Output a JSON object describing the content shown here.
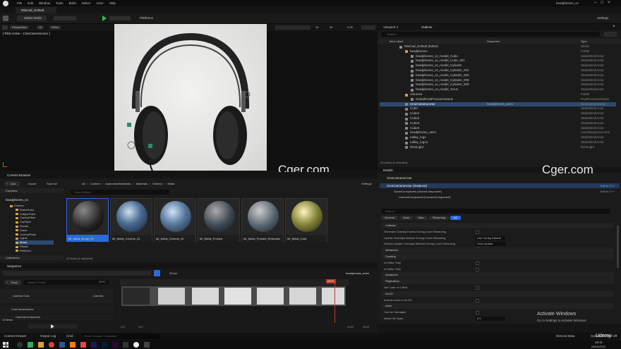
{
  "window": {
    "title": "headphones_xs",
    "menus": [
      "File",
      "Edit",
      "Window",
      "Tools",
      "Build",
      "Select",
      "Actor",
      "Help"
    ],
    "level_tab": "Minimal_Default"
  },
  "toolbar": {
    "select_mode": "Select Mode",
    "platforms": "Platforms",
    "settings": "Settings"
  },
  "viewport": {
    "perspective": "Perspective",
    "lit": "Lit",
    "show": "Show",
    "pilot": "[ Pilot Active - CineCameraActor ]",
    "fov": "90",
    "scale": "0.25",
    "snap": "10"
  },
  "watermark": "Cger.com",
  "outliner": {
    "tab_viewport2": "Viewport 2",
    "tab_outliner": "Outliner",
    "search_placeholder": "Search...",
    "col_label": "Item Label",
    "col_sequence": "Sequence",
    "col_type": "Type",
    "footer": "23 actors (1 selected)",
    "rows": [
      {
        "name": "Minimal_Default (Editor)",
        "type": "World",
        "seq": ""
      },
      {
        "name": "headphones",
        "type": "Folder",
        "seq": ""
      },
      {
        "name": "headphones_xs_model_Cube",
        "type": "StaticMeshActor",
        "seq": ""
      },
      {
        "name": "headphones_xs_model_Cube_001",
        "type": "StaticMeshActor",
        "seq": ""
      },
      {
        "name": "headphones_xs_model_Cylinder",
        "type": "StaticMeshActor",
        "seq": ""
      },
      {
        "name": "headphones_xs_model_Cylinder_002",
        "type": "StaticMeshActor",
        "seq": ""
      },
      {
        "name": "headphones_xs_model_Cylinder_003",
        "type": "StaticMeshActor",
        "seq": ""
      },
      {
        "name": "headphones_xs_model_Cylinder_008",
        "type": "StaticMeshActor",
        "seq": ""
      },
      {
        "name": "headphones_xs_model_Cylinder_009",
        "type": "StaticMeshActor",
        "seq": ""
      },
      {
        "name": "headphones_xs_model_Torus",
        "type": "StaticMeshActor",
        "seq": ""
      },
      {
        "name": "Volumes",
        "type": "Folder",
        "seq": ""
      },
      {
        "name": "GlobalPostProcessVolume",
        "type": "PostProcessVolume",
        "seq": ""
      },
      {
        "name": "CineCameraActor",
        "type": "CineCameraActor",
        "seq": "headphones_anim"
      },
      {
        "name": "Cube",
        "type": "StaticMeshActor",
        "seq": ""
      },
      {
        "name": "Cube2",
        "type": "StaticMeshActor",
        "seq": ""
      },
      {
        "name": "Cube3",
        "type": "StaticMeshActor",
        "seq": ""
      },
      {
        "name": "Cube4",
        "type": "StaticMeshActor",
        "seq": ""
      },
      {
        "name": "Cube5",
        "type": "StaticMeshActor",
        "seq": ""
      },
      {
        "name": "headphones_anim",
        "type": "LevelSequenceActor",
        "seq": ""
      },
      {
        "name": "nallay_logo",
        "type": "StaticMeshActor",
        "seq": ""
      },
      {
        "name": "nallay_logo2",
        "type": "StaticMeshActor",
        "seq": ""
      },
      {
        "name": "RectLight",
        "type": "RectLight",
        "seq": ""
      }
    ]
  },
  "details": {
    "tab": "Details",
    "actor_name": "CineCameraActor",
    "instance": "CineCameraActor (Instance)",
    "component1": "SceneComponent (SceneComponent)",
    "component2": "CameraComponent (CameraComponent)",
    "edit_cpp": "Edit in C++",
    "search_placeholder": "Search",
    "filters": [
      "General",
      "Actor",
      "Misc",
      "Streaming",
      "All"
    ],
    "rows": [
      {
        "section": "Collision"
      },
      {
        "label": "Generate Overlap Events During Level Streaming",
        "value": ""
      },
      {
        "label": "Update Overlaps Method During Level Streaming",
        "value": "Use Config Default"
      },
      {
        "label": "Default Update Overlaps Method During Level Streaming",
        "value": "Only Update Movable"
      },
      {
        "section": "Advanced"
      },
      {
        "section": "Cooking"
      },
      {
        "label": "Is Editor Only",
        "value": ""
      },
      {
        "label": "Is Editor Only",
        "value": ""
      },
      {
        "section": "Advanced"
      },
      {
        "section": "Replication"
      },
      {
        "label": "Net Load on Client",
        "value": ""
      },
      {
        "section": "HLOD"
      },
      {
        "label": "Include Actor in HLOD",
        "value": ""
      },
      {
        "section": "Actor"
      },
      {
        "label": "Can be Damaged",
        "value": ""
      },
      {
        "label": "Initial Life Span",
        "value": "0.0"
      }
    ]
  },
  "content_browser": {
    "tab": "Content Browser",
    "add": "Add",
    "import": "Import",
    "save_all": "Save All",
    "settings": "Settings",
    "breadcrumb": [
      "All",
      "Content",
      "AutomotiveMaterials",
      "Materials",
      "Exterior",
      "Metal"
    ],
    "favorites": "Favorites",
    "root": "headphones_xs",
    "search_placeholder": "Search Metal",
    "collections": "Collections",
    "status": "22 items (1 selected)",
    "folders": [
      "Exterior",
      "BrakeRotor",
      "CaliperPaint",
      "CarbonFiber",
      "CarPaint",
      "Decals",
      "Glass",
      "LicensePlate",
      "Lights",
      "Metal",
      "Plastic",
      "Reflector"
    ],
    "assets": [
      "MI_Metal_Bump_02",
      "MI_Metal_Chrome_01",
      "MI_Metal_Chrome_02",
      "MI_Metal_Frosted",
      "MI_Metal_Frosted_Reflection",
      "MI_Metal_Gold"
    ]
  },
  "sequencer": {
    "tab": "Sequence",
    "track": "Track",
    "search_placeholder": "Search Tracks",
    "fps": "30 fps",
    "sequence_name": "headphones_anim",
    "frame_start": "0000",
    "frame_current": "0473",
    "time_label": "0473",
    "camera_cuts": "Camera Cuts",
    "camera_btn": "Camera",
    "cine_actor": "CineCameraActor",
    "camera_component": "CameraComponent",
    "items_count": "19 items",
    "start_a": "-017",
    "start_b": "-007",
    "end_a": "0590",
    "end_b": "0595"
  },
  "statusbar": {
    "content_drawer": "Content Drawer",
    "output_log": "Output Log",
    "cmd": "Cmd",
    "cmd_placeholder": "Enter Console Command",
    "derived_data": "Derived Data",
    "source_control": "Source Control Off"
  },
  "activate": {
    "title": "Activate Windows",
    "subtitle": "Go to Settings to activate Windows"
  },
  "taskbar": {
    "time": "16:11",
    "date": "08/05/2022",
    "udemy": "Udemy"
  }
}
